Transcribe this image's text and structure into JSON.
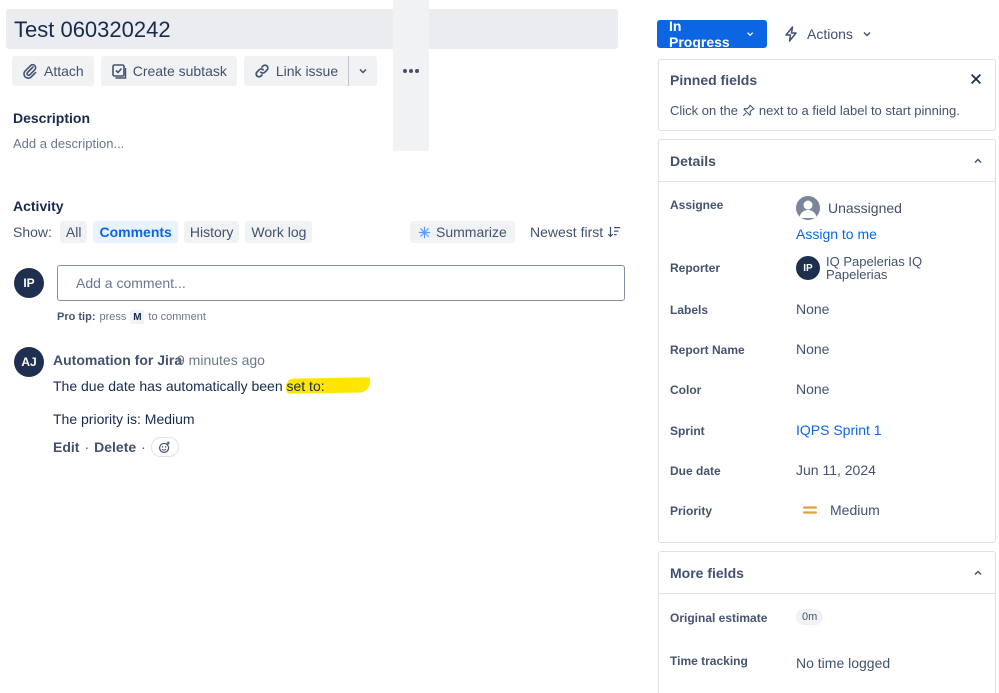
{
  "issue": {
    "title": "Test 060320242"
  },
  "toolbar": {
    "attach": "Attach",
    "create_subtask": "Create subtask",
    "link_issue": "Link issue"
  },
  "description": {
    "label": "Description",
    "placeholder": "Add a description..."
  },
  "activity": {
    "label": "Activity",
    "show_label": "Show:",
    "filters": [
      "All",
      "Comments",
      "History",
      "Work log"
    ],
    "active_filter": "Comments",
    "summarize": "Summarize",
    "sort": "Newest first"
  },
  "comment_box": {
    "avatar_initials": "IP",
    "placeholder": "Add a comment...",
    "protip_bold": "Pro tip:",
    "protip_pre": "press",
    "protip_key": "M",
    "protip_post": "to comment"
  },
  "comment": {
    "avatar_initials": "AJ",
    "author": "Automation for Jira",
    "time": "9 minutes ago",
    "line1": "The due date has automatically been set to:",
    "line2": "The priority is: Medium",
    "edit": "Edit",
    "delete": "Delete",
    "separator": "·"
  },
  "status": {
    "label": "In Progress",
    "actions": "Actions",
    "color": "#0c66e4"
  },
  "pinned": {
    "title": "Pinned fields",
    "text_before": "Click on the",
    "text_after": "next to a field label to start pinning."
  },
  "details": {
    "title": "Details",
    "assignee": {
      "label": "Assignee",
      "value": "Unassigned",
      "assign_link": "Assign to me"
    },
    "reporter": {
      "label": "Reporter",
      "initials": "IP",
      "name_line1": "IQ Papelerias IQ",
      "name_line2": "Papelerias"
    },
    "labels": {
      "label": "Labels",
      "value": "None"
    },
    "report_name": {
      "label": "Report Name",
      "value": "None"
    },
    "color": {
      "label": "Color",
      "value": "None"
    },
    "sprint": {
      "label": "Sprint",
      "value": "IQPS Sprint 1"
    },
    "due_date": {
      "label": "Due date",
      "value": "Jun 11, 2024"
    },
    "priority": {
      "label": "Priority",
      "value": "Medium",
      "color": "#e2a03f"
    }
  },
  "more_fields": {
    "title": "More fields",
    "original_estimate": {
      "label": "Original estimate",
      "value": "0m"
    },
    "time_tracking": {
      "label": "Time tracking",
      "value": "No time logged"
    }
  },
  "colors": {
    "link": "#0c66e4",
    "highlight": "#ffe500",
    "text": "#172b4d"
  }
}
